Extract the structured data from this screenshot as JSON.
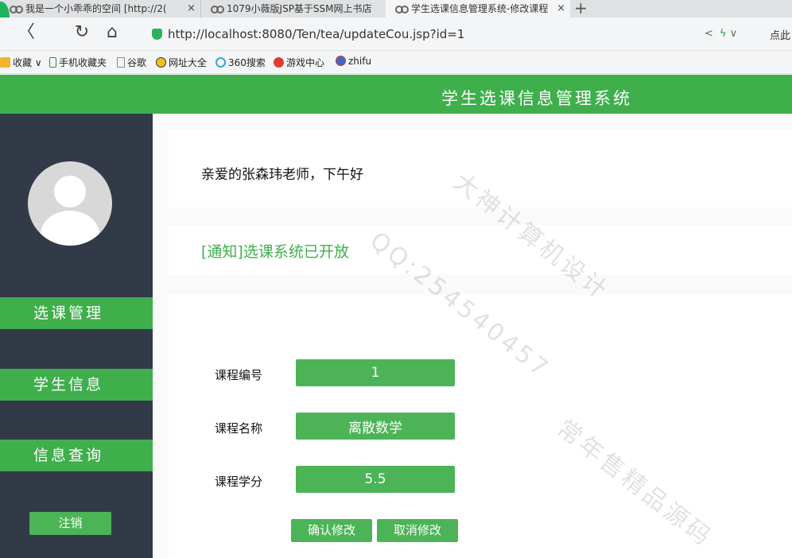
{
  "browser": {
    "tabs": [
      {
        "title": "我是一个小乖乖的空间 [http://2("
      },
      {
        "title": "1079小薇版JSP基于SSM网上书店"
      },
      {
        "title": "学生选课信息管理系统-修改课程"
      }
    ],
    "close_glyph": "×",
    "new_tab_glyph": "+",
    "url": "http://localhost:8080/Ten/tea/updateCou.jsp?id=1",
    "nav_glyphs": {
      "back": "〈",
      "reload": "↻",
      "home": "⌂"
    },
    "right_click_label": "点此",
    "bookmarks": [
      {
        "label": "收藏 ∨",
        "icon": "star-icon"
      },
      {
        "label": "手机收藏夹",
        "icon": "phone-icon"
      },
      {
        "label": "谷歌",
        "icon": "page-icon"
      },
      {
        "label": "网址大全",
        "icon": "compass-icon"
      },
      {
        "label": "360搜索",
        "icon": "ring-icon"
      },
      {
        "label": "游戏中心",
        "icon": "game-icon"
      },
      {
        "label": "zhifu",
        "icon": "globe-icon"
      }
    ]
  },
  "app": {
    "title": "学生选课信息管理系统",
    "sidebar": {
      "items": [
        {
          "label": "选课管理"
        },
        {
          "label": "学生信息"
        },
        {
          "label": "信息查询"
        }
      ],
      "logout_label": "注销"
    },
    "greeting": "亲爱的张森玮老师，下午好",
    "notice": "[通知]选课系统已开放",
    "form": {
      "course_id_label": "课程编号",
      "course_id_value": "1",
      "course_name_label": "课程名称",
      "course_name_value": "离散数学",
      "course_credit_label": "课程学分",
      "course_credit_value": "5.5",
      "confirm_label": "确认修改",
      "cancel_label": "取消修改"
    },
    "colors": {
      "accent": "#3faf4c",
      "sidebar_bg": "#323a48"
    }
  },
  "watermark": {
    "lines": [
      "大神计算机设计",
      "QQ:254540457",
      "常年售精品源码"
    ]
  }
}
